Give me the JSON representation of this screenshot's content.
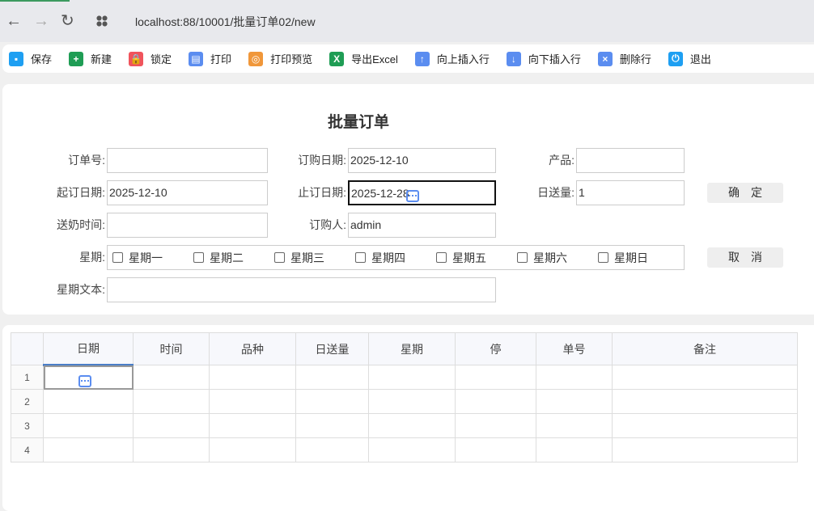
{
  "browser": {
    "url": "localhost:88/10001/批量订单02/new",
    "back": "←",
    "forward": "→",
    "reload": "↻"
  },
  "toolbar": [
    {
      "label": "保存",
      "icon": "save-icon",
      "color": "#1e9ff2",
      "glyph": "▪"
    },
    {
      "label": "新建",
      "icon": "new-icon",
      "color": "#1f9d55",
      "glyph": "+"
    },
    {
      "label": "锁定",
      "icon": "lock-icon",
      "color": "#f0545c",
      "glyph": "🔒"
    },
    {
      "label": "打印",
      "icon": "printer-icon",
      "color": "#5b8df0",
      "glyph": "▤"
    },
    {
      "label": "打印预览",
      "icon": "print-preview-icon",
      "color": "#f0973a",
      "glyph": "◎"
    },
    {
      "label": "导出Excel",
      "icon": "excel-icon",
      "color": "#1f9d55",
      "glyph": "X"
    },
    {
      "label": "向上插入行",
      "icon": "insert-above-icon",
      "color": "#5b8df0",
      "glyph": "↑"
    },
    {
      "label": "向下插入行",
      "icon": "insert-below-icon",
      "color": "#5b8df0",
      "glyph": "↓"
    },
    {
      "label": "删除行",
      "icon": "delete-row-icon",
      "color": "#5b8df0",
      "glyph": "×"
    },
    {
      "label": "退出",
      "icon": "power-icon",
      "color": "#1e9ff2",
      "glyph": "⏻"
    }
  ],
  "form": {
    "title": "批量订单",
    "order_no": {
      "label": "订单号:",
      "value": ""
    },
    "order_date": {
      "label": "订购日期:",
      "value": "2025-12-10"
    },
    "product": {
      "label": "产品:",
      "value": ""
    },
    "start_date": {
      "label": "起订日期:",
      "value": "2025-12-10"
    },
    "end_date": {
      "label": "止订日期:",
      "value": "2025-12-28"
    },
    "daily_qty": {
      "label": "日送量:",
      "value": "1"
    },
    "delivery_time": {
      "label": "送奶时间:",
      "value": ""
    },
    "buyer": {
      "label": "订购人:",
      "value": "admin"
    },
    "weekday": {
      "label": "星期:",
      "options": [
        "星期一",
        "星期二",
        "星期三",
        "星期四",
        "星期五",
        "星期六",
        "星期日"
      ]
    },
    "weekday_text": {
      "label": "星期文本:",
      "value": ""
    },
    "confirm": "确定",
    "cancel": "取消"
  },
  "grid": {
    "columns": [
      "日期",
      "时间",
      "品种",
      "日送量",
      "星期",
      "停",
      "单号",
      "备注"
    ],
    "rows": [
      "1",
      "2",
      "3",
      "4"
    ]
  }
}
